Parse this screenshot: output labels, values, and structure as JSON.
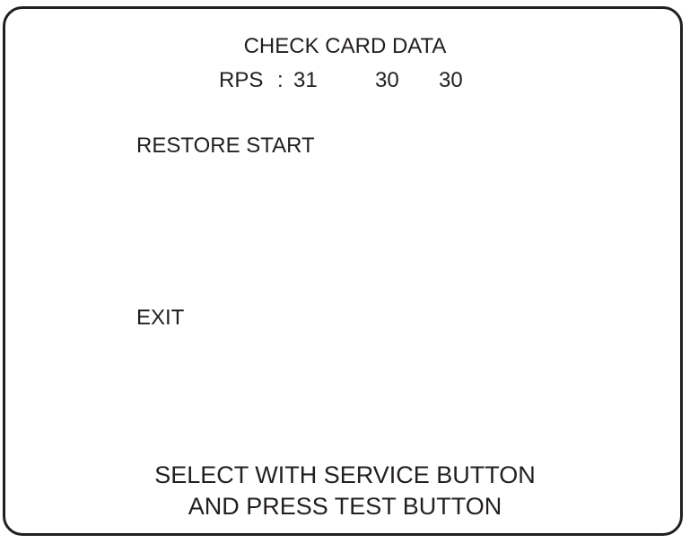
{
  "screen": {
    "title": "CHECK CARD DATA",
    "rps": {
      "label": "RPS",
      "separator": ":",
      "values": [
        "31",
        "30",
        "30"
      ]
    },
    "menu": {
      "restore_start": "RESTORE START",
      "exit": "EXIT"
    },
    "footer": {
      "line1": "SELECT WITH SERVICE BUTTON",
      "line2": "AND PRESS TEST BUTTON"
    }
  }
}
